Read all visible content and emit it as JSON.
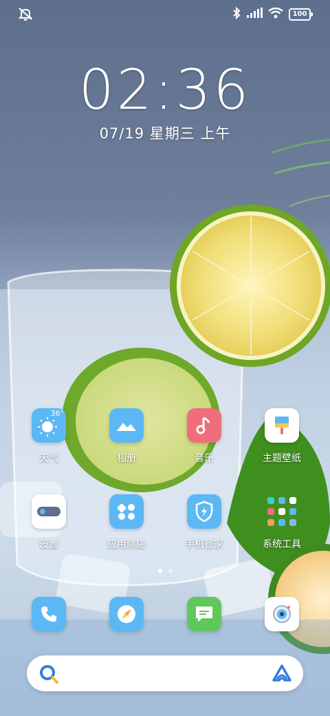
{
  "status_bar": {
    "left_icon": "dnd-bell-off-icon",
    "right_icons": [
      "bluetooth-icon",
      "signal-icon",
      "wifi-icon"
    ],
    "battery": "100"
  },
  "lock": {
    "time": "02:36",
    "date": "07/19 星期三 上午"
  },
  "apps_row1": [
    {
      "label": "天气",
      "icon": "weather-sun-icon",
      "badge": "36°",
      "color": "#5cb8f4"
    },
    {
      "label": "相册",
      "icon": "gallery-mountain-icon",
      "color": "#5cb8f4"
    },
    {
      "label": "音乐",
      "icon": "music-note-icon",
      "color": "#f06e7c"
    },
    {
      "label": "主题壁纸",
      "icon": "theme-brush-icon",
      "color": "#ffffff"
    }
  ],
  "apps_row2": [
    {
      "label": "设置",
      "icon": "settings-toggle-icon",
      "color": "#ffffff"
    },
    {
      "label": "应用商店",
      "icon": "app-store-grid-icon",
      "color": "#5cb8f4"
    },
    {
      "label": "手机管家",
      "icon": "security-shield-icon",
      "color": "#5cb8f4"
    },
    {
      "label": "系统工具",
      "icon": "folder-icon",
      "color": "#333333"
    }
  ],
  "dock": [
    {
      "icon": "phone-icon",
      "color": "#5cb8f4"
    },
    {
      "icon": "browser-compass-icon",
      "color": "#5cb8f4"
    },
    {
      "icon": "message-icon",
      "color": "#5fc85b"
    },
    {
      "icon": "camera-icon",
      "color": "#ffffff"
    }
  ],
  "pages": {
    "count": 2,
    "active": 0
  },
  "search": {
    "placeholder": ""
  }
}
